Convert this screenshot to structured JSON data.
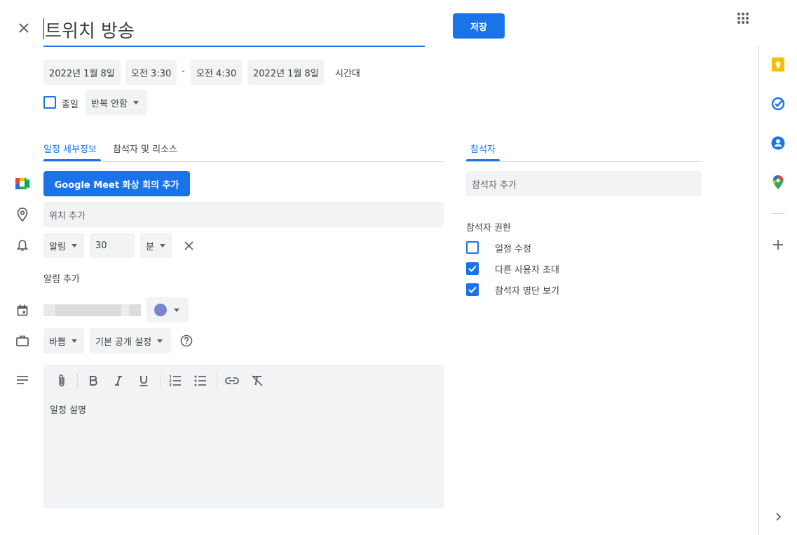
{
  "header": {
    "title": "트위치 방송",
    "save_label": "저장"
  },
  "datetime": {
    "start_date": "2022년 1월 8일",
    "start_time": "오전 3:30",
    "separator": "-",
    "end_time": "오전 4:30",
    "end_date": "2022년 1월 8일",
    "timezone_label": "시간대"
  },
  "options": {
    "all_day_label": "종일",
    "repeat_label": "반복 안함"
  },
  "tabs": [
    {
      "label": "일정 세부정보",
      "active": true
    },
    {
      "label": "참석자 및 리소스",
      "active": false
    }
  ],
  "details": {
    "meet_button": "Google Meet 화상 회의 추가",
    "location_placeholder": "위치 추가",
    "notification_type": "알림",
    "notification_value": "30",
    "notification_unit": "분",
    "add_notification": "알림 추가",
    "busy_label": "바쁨",
    "visibility_label": "기본 공개 설정",
    "description_placeholder": "일정 설명"
  },
  "guests": {
    "tab_label": "참석자",
    "add_placeholder": "참석자 추가",
    "permissions_title": "참석자 권한",
    "permissions": [
      {
        "label": "일정 수정",
        "checked": false
      },
      {
        "label": "다른 사용자 초대",
        "checked": true
      },
      {
        "label": "참석자 명단 보기",
        "checked": true
      }
    ]
  },
  "colors": {
    "accent": "#1a73e8",
    "event_color": "#7986cb",
    "field_bg": "#f1f3f4"
  }
}
